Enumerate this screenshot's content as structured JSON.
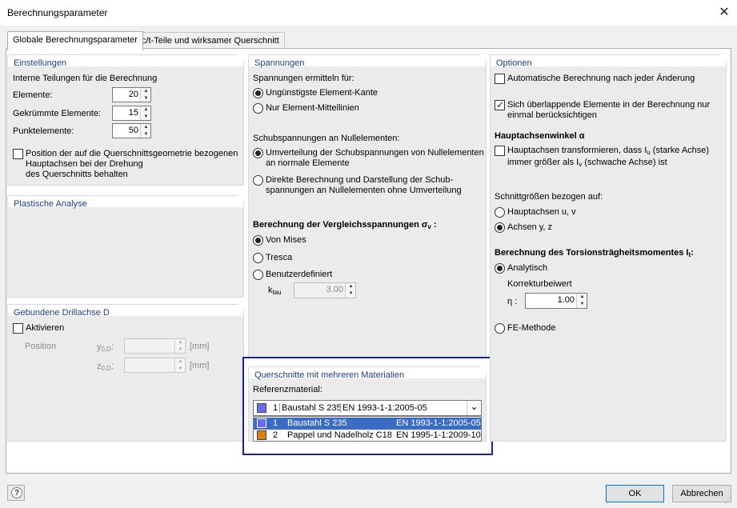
{
  "window": {
    "title": "Berechnungsparameter",
    "close_glyph": "✕"
  },
  "tabs": [
    {
      "label": "Globale Berechnungsparameter"
    },
    {
      "label": "c/t-Teile und wirksamer Querschnitt"
    }
  ],
  "einstellungen": {
    "title": "Einstellungen",
    "subtitle": "Interne Teilungen für die Berechnung",
    "elemente_label": "Elemente:",
    "elemente_value": "20",
    "gekruemmte_label": "Gekrümmte Elemente:",
    "gekruemmte_value": "15",
    "punkt_label": "Punktelemente:",
    "punkt_value": "50",
    "position_line1": "Position der auf die Querschnittsgeometrie bezogenen",
    "position_line2": "Hauptachsen bei der Drehung",
    "position_line3": "des Querschnitts behalten",
    "position_checked": false
  },
  "plastische": {
    "title": "Plastische Analyse"
  },
  "drillachse": {
    "title": "Gebundene Drillachse D",
    "aktivieren_label": "Aktivieren",
    "aktivieren_checked": false,
    "position_label": "Position",
    "y_label": "y",
    "y_sub": "0,D",
    "z_label": "z",
    "z_sub": "0,D",
    "colon": ":",
    "y_unit": "[mm]",
    "z_unit": "[mm]",
    "y_value": "",
    "z_value": ""
  },
  "spannungen": {
    "title": "Spannungen",
    "ermitteln_label": "Spannungen ermitteln für:",
    "opt1": "Ungünstigste Element-Kante",
    "opt2": "Nur Element-Mittellinien",
    "schub_label": "Schubspannungen an Nullelementen:",
    "schub_opt1_line1": "Umverteilung der Schubspannungen von Nullelementen",
    "schub_opt1_line2": "an normale Elemente",
    "schub_opt2_line1": "Direkte Berechnung und Darstellung der Schub-",
    "schub_opt2_line2": "spannungen an Nullelementen ohne Umverteilung",
    "vergleich_label": "Berechnung der Vergleichsspannungen σ",
    "vergleich_sub": "v",
    "vergleich_colon": ":",
    "vonmises": "Von Mises",
    "tresca": "Tresca",
    "benutzer": "Benutzerdefiniert",
    "ktau_label": "k",
    "ktau_sub": "tau",
    "ktau_value": "3.00"
  },
  "materialien": {
    "title": "Querschnitte mit mehreren Materialien",
    "ref_label": "Referenzmaterial:",
    "selected_num": "1",
    "selected_name": "Baustahl S 235",
    "selected_norm": "EN 1993-1-1:2005-05",
    "selected_color": "#6b6bef",
    "chevron": "⌄",
    "options": [
      {
        "num": "1",
        "name": "Baustahl S 235",
        "norm": "EN 1993-1-1:2005-05",
        "color": "#6b6bef"
      },
      {
        "num": "2",
        "name": "Pappel und Nadelholz C18",
        "norm": "EN 1995-1-1:2009-10",
        "color": "#d98010"
      }
    ]
  },
  "optionen": {
    "title": "Optionen",
    "auto_label": "Automatische Berechnung nach jeder Änderung",
    "auto_checked": false,
    "overlap_line1": "Sich überlappende Elemente in der Berechnung nur",
    "overlap_line2": "einmal berücksichtigen",
    "overlap_checked": true,
    "haupt_title": "Hauptachsenwinkel α",
    "haupt_line1": "Hauptachsen transformieren, dass I",
    "haupt_sub1": "u",
    "haupt_line1b": " (starke Achse)",
    "haupt_line2": "immer größer als I",
    "haupt_sub2": "v",
    "haupt_line2b": " (schwache Achse) ist",
    "haupt_checked": false,
    "schnitt_label": "Schnittgrößen bezogen auf:",
    "schnitt_opt1": "Hauptachsen u, v",
    "schnitt_opt2": "Achsen y, z",
    "torsion_title": "Berechnung des Torsionsträgheitsmomentes I",
    "torsion_sub": "t",
    "torsion_colon": ":",
    "analytisch": "Analytisch",
    "korrektur_label": "Korrekturbeiwert",
    "eta_label": "η :",
    "eta_value": "1.00",
    "fe_label": "FE-Methode"
  },
  "buttons": {
    "help": "?",
    "ok": "OK",
    "cancel": "Abbrechen",
    "grip": "⋰"
  }
}
